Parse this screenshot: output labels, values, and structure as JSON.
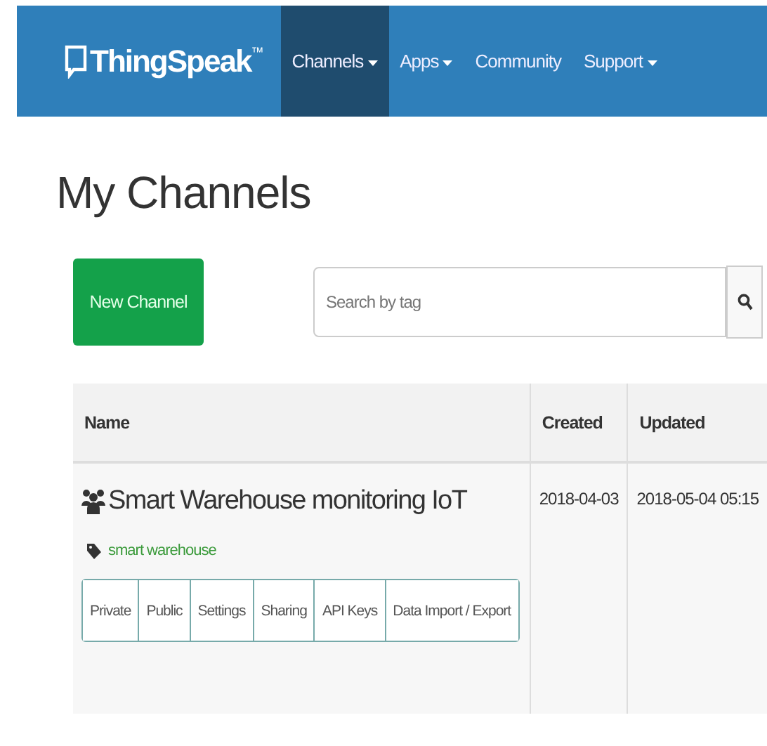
{
  "navbar": {
    "brand": "ThingSpeak",
    "trademark": "™",
    "items": [
      {
        "label": "Channels",
        "selected": true,
        "has_menu": true
      },
      {
        "label": "Apps",
        "selected": false,
        "has_menu": true
      },
      {
        "label": "Community",
        "selected": false,
        "has_menu": false
      },
      {
        "label": "Support",
        "selected": false,
        "has_menu": true
      }
    ]
  },
  "page_title": "My Channels",
  "new_button": "New Channel",
  "search": {
    "placeholder": "Search by tag"
  },
  "table": {
    "columns": [
      "Name",
      "Created",
      "Updated"
    ],
    "rows": [
      {
        "name": "Smart Warehouse monitoring IoT",
        "tag": "smart warehouse",
        "created": "2018-04-03",
        "updated": "2018-05-04 05:15",
        "actions": [
          "Private",
          "Public",
          "Settings",
          "Sharing",
          "API Keys",
          "Data Import / Export"
        ]
      }
    ]
  }
}
